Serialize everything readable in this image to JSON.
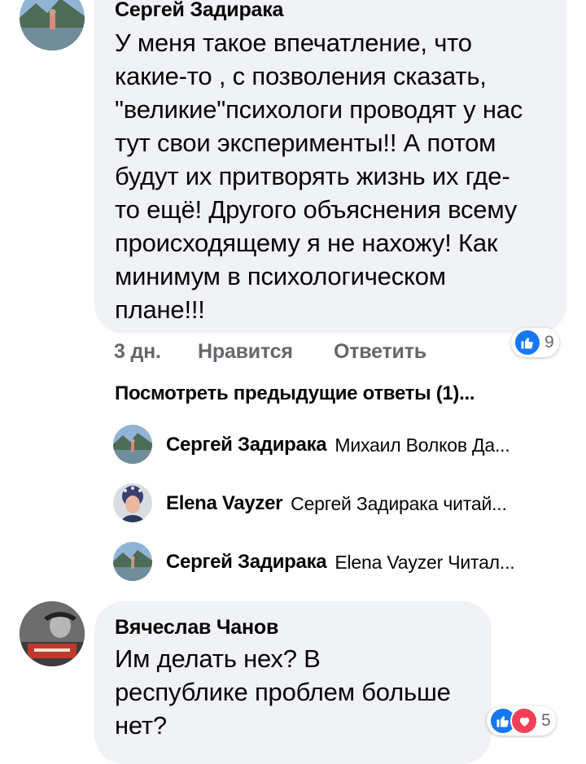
{
  "comments": [
    {
      "author": "Сергей Задирака",
      "text": "У меня такое впечатление, что\nкакие-то , с позволения сказать,\n\"великие\"психологи проводят у нас\nтут свои эксперименты!! А потом\nбудут их притворять жизнь их где-\nто ещё! Другого объяснения  всему\nпроисходящему  я не нахожу! Как\nминимум в  психологическом\nплане!!!",
      "time": "3 дн.",
      "like_label": "Нравится",
      "reply_label": "Ответить",
      "reaction_count": "9"
    },
    {
      "author": "Вячеслав Чанов",
      "text": "Им делать нех? В\nреспублике проблем больше\nнет?",
      "reaction_count": "5"
    }
  ],
  "previous_replies_label": "Посмотреть предыдущие ответы (1)...",
  "replies": [
    {
      "author": "Сергей Задирака",
      "text": "Михаил Волков Да..."
    },
    {
      "author": "Elena Vayzer",
      "text": "Сергей Задирака  читай..."
    },
    {
      "author": "Сергей Задирака",
      "text": "Elena Vayzer Читал..."
    }
  ],
  "colors": {
    "bubble": "#f0f2f5",
    "like_blue": "#1877f2",
    "love_red": "#f33e58",
    "secondary_text": "#65676b"
  },
  "icons": {
    "like": "thumbs-up-icon",
    "love": "heart-icon"
  }
}
